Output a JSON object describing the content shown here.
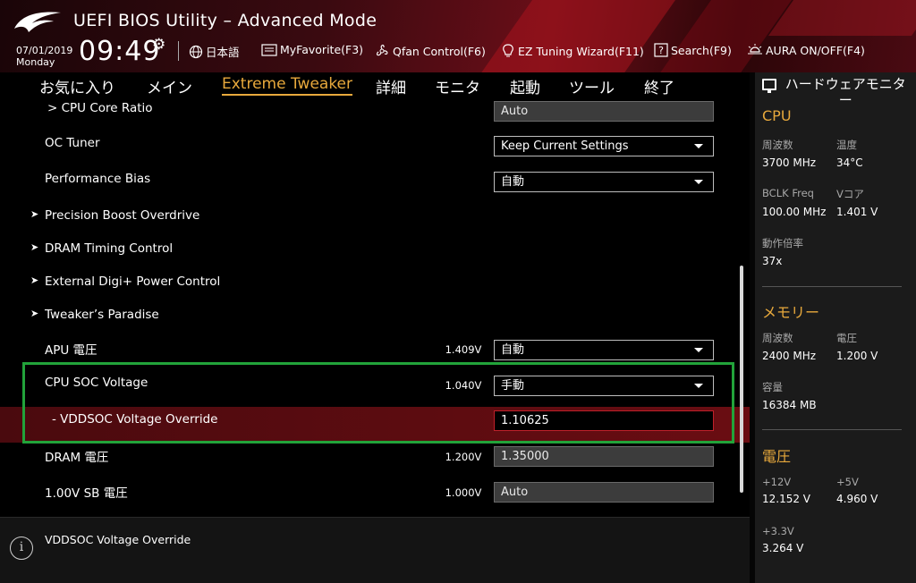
{
  "header": {
    "title": "UEFI BIOS Utility – Advanced Mode",
    "date": "07/01/2019",
    "day": "Monday",
    "time": "09:49",
    "items": [
      {
        "icon": "globe-icon",
        "label": "日本語"
      },
      {
        "icon": "myfavorite-icon",
        "label": "MyFavorite(F3)"
      },
      {
        "icon": "fan-icon",
        "label": "Qfan Control(F6)"
      },
      {
        "icon": "lightbulb-icon",
        "label": "EZ Tuning Wizard(F11)"
      },
      {
        "icon": "search-icon",
        "label": "Search(F9)"
      },
      {
        "icon": "aura-icon",
        "label": "AURA ON/OFF(F4)"
      }
    ]
  },
  "tabs": [
    "お気に入り",
    "メイン",
    "Extreme Tweaker",
    "詳細",
    "モニタ",
    "起動",
    "ツール",
    "終了"
  ],
  "active_tab": "Extreme Tweaker",
  "settings": {
    "cpu_core_ratio": {
      "label": "> CPU Core Ratio",
      "value": "Auto"
    },
    "oc_tuner": {
      "label": "OC Tuner",
      "value": "Keep Current Settings"
    },
    "performance_bias": {
      "label": "Performance Bias",
      "value": "自動"
    },
    "precision_boost": {
      "label": "Precision Boost Overdrive"
    },
    "dram_timing": {
      "label": "DRAM Timing Control"
    },
    "digi_power": {
      "label": "External Digi+ Power Control"
    },
    "tweakers_paradise": {
      "label": "Tweaker’s Paradise"
    },
    "apu_voltage": {
      "label": "APU 電圧",
      "reading": "1.409V",
      "value": "自動"
    },
    "cpu_soc_voltage": {
      "label": "CPU SOC Voltage",
      "reading": "1.040V",
      "value": "手動"
    },
    "vddsoc_override": {
      "label": "- VDDSOC Voltage Override",
      "value": "1.10625"
    },
    "dram_voltage": {
      "label": "DRAM 電圧",
      "reading": "1.200V",
      "value": "1.35000"
    },
    "sb_voltage": {
      "label": "1.00V SB 電圧",
      "reading": "1.000V",
      "value": "Auto"
    }
  },
  "help": {
    "text": "VDDSOC Voltage Override"
  },
  "monitor": {
    "title": "ハードウェアモニター",
    "cpu": {
      "title": "CPU",
      "freq_label": "周波数",
      "freq": "3700 MHz",
      "temp_label": "温度",
      "temp": "34°C",
      "bclk_label": "BCLK Freq",
      "bclk": "100.00 MHz",
      "vcore_label": "Vコア",
      "vcore": "1.401 V",
      "ratio_label": "動作倍率",
      "ratio": "37x"
    },
    "memory": {
      "title": "メモリー",
      "freq_label": "周波数",
      "freq": "2400 MHz",
      "volt_label": "電圧",
      "volt": "1.200 V",
      "cap_label": "容量",
      "cap": "16384 MB"
    },
    "voltage": {
      "title": "電圧",
      "v12_label": "+12V",
      "v12": "12.152 V",
      "v5_label": "+5V",
      "v5": "4.960 V",
      "v33_label": "+3.3V",
      "v33": "3.264 V"
    }
  },
  "colors": {
    "accent": "#e8a93c",
    "highlight_row": "#6a0d12",
    "focus_box": "#22a33a"
  }
}
